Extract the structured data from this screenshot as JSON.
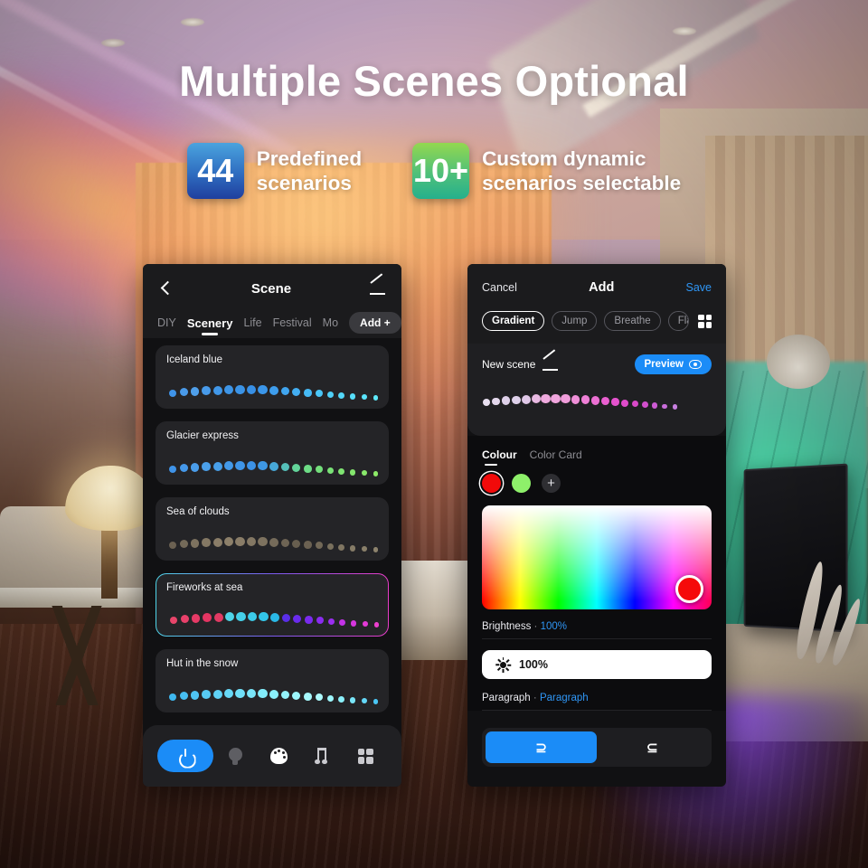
{
  "promo": {
    "headline": "Multiple Scenes Optional",
    "badges": [
      {
        "value": "44",
        "line1": "Predefined",
        "line2": "scenarios",
        "color": "#2f6dc0"
      },
      {
        "value": "10+",
        "line1": "Custom dynamic",
        "line2": "scenarios selectable",
        "color": "#4fc07a"
      }
    ]
  },
  "left_phone": {
    "header": {
      "back_icon": "chevron-left-icon",
      "title": "Scene",
      "edit_icon": "pencil-icon"
    },
    "tabs": [
      {
        "label": "DIY",
        "active": false
      },
      {
        "label": "Scenery",
        "active": true
      },
      {
        "label": "Life",
        "active": false
      },
      {
        "label": "Festival",
        "active": false
      },
      {
        "label": "Mo",
        "active": false
      }
    ],
    "add_button": "Add +",
    "scenes": [
      {
        "name": "Iceland blue",
        "selected": false,
        "colors": [
          "#3f93e8",
          "#4a9ae9",
          "#4f9fea",
          "#489ae9",
          "#4197e8",
          "#3e95e7",
          "#3b93e6",
          "#3890e6",
          "#3b96ea",
          "#3e9ded",
          "#40a5ef",
          "#43aef2",
          "#46baf5",
          "#4ac6f7",
          "#4fd0f8",
          "#53d8f9",
          "#57dffa",
          "#5ae4fb",
          "#5ee9fb"
        ]
      },
      {
        "name": "Glacier express",
        "selected": false,
        "colors": [
          "#3f93e8",
          "#4598e9",
          "#4a9dea",
          "#4ba0ea",
          "#489fe9",
          "#4399e8",
          "#3f95e7",
          "#3c92e6",
          "#3e97e4",
          "#47a8d8",
          "#55bfb9",
          "#63d49a",
          "#6ddc86",
          "#74df7c",
          "#7ae277",
          "#7fe472",
          "#84e66e",
          "#88e86b",
          "#8dea68"
        ]
      },
      {
        "name": "Sea of clouds",
        "selected": false,
        "colors": [
          "#6b6152",
          "#746a59",
          "#7d725f",
          "#847864",
          "#8a7d68",
          "#8d806a",
          "#8a7d68",
          "#847864",
          "#7d725f",
          "#756b5a",
          "#6e6454",
          "#675e4f",
          "#6b6152",
          "#726857",
          "#79705d",
          "#807662",
          "#867c67",
          "#8a806a",
          "#8d836d"
        ]
      },
      {
        "name": "Fireworks at sea",
        "selected": true,
        "colors": [
          "#e8456a",
          "#e8406a",
          "#e63a66",
          "#e43562",
          "#e13a63",
          "#4fd4e8",
          "#45cfe8",
          "#3ccbe9",
          "#33c6e9",
          "#2ab8e6",
          "#5a2ee8",
          "#6a2bec",
          "#7a2bee",
          "#8a2cef",
          "#9a2ef0",
          "#c233e6",
          "#d636de",
          "#e33ad6",
          "#ec3fce"
        ]
      },
      {
        "name": "Hut in the snow",
        "selected": false,
        "colors": [
          "#3fb8f0",
          "#47bef2",
          "#4fc4f3",
          "#57cbf4",
          "#5fd2f6",
          "#67d9f7",
          "#70e0f8",
          "#79e6f9",
          "#82ecfa",
          "#8bf0fb",
          "#94f3fb",
          "#9df6fc",
          "#a6f8fc",
          "#aefafd",
          "#9df6fc",
          "#8bf0fb",
          "#79e6f9",
          "#63d6f6",
          "#4ac6f4"
        ]
      }
    ],
    "toolbar": {
      "power_icon": "power-icon",
      "items": [
        {
          "icon": "bulb-icon",
          "active": false
        },
        {
          "icon": "palette-icon",
          "active": true
        },
        {
          "icon": "music-note-icon",
          "active": false
        },
        {
          "icon": "grid-icon",
          "active": false
        }
      ]
    }
  },
  "right_phone": {
    "header": {
      "cancel": "Cancel",
      "title": "Add",
      "save": "Save"
    },
    "modes": [
      {
        "label": "Gradient",
        "active": true
      },
      {
        "label": "Jump",
        "active": false
      },
      {
        "label": "Breathe",
        "active": false
      },
      {
        "label": "Flashing",
        "active": false
      }
    ],
    "mode_grid_icon": "grid-icon",
    "scene": {
      "name": "New scene",
      "edit_icon": "pencil-icon",
      "preview_label": "Preview",
      "preview_icon": "eye-icon",
      "preview_colors": [
        "#e8dff0",
        "#e3d7ec",
        "#ded0e9",
        "#ded0ea",
        "#e0c8e8",
        "#e8b9e2",
        "#efaade",
        "#f0a5dd",
        "#f09ddb",
        "#ef8fd8",
        "#ee7fd6",
        "#ec6fd3",
        "#e95fd0",
        "#e452cd",
        "#df4bcb",
        "#d949c9",
        "#d24fcd",
        "#cc5ad3",
        "#c96cda",
        "#c87fe0"
      ]
    },
    "color_tabs": [
      {
        "label": "Colour",
        "active": true
      },
      {
        "label": "Color Card",
        "active": false
      }
    ],
    "swatches": [
      {
        "color": "#f20a0a",
        "selected": true
      },
      {
        "color": "#8ef06a",
        "selected": false
      }
    ],
    "add_swatch_label": "+",
    "picker": {
      "selected_color": "#f50a0a",
      "knob_name": "color-picker-knob"
    },
    "brightness": {
      "label": "Brightness",
      "separator": "·",
      "value": "100%",
      "slider_icon": "sun-icon",
      "slider_value": "100%"
    },
    "paragraph": {
      "label": "Paragraph",
      "separator": "·",
      "value": "Paragraph"
    },
    "direction": [
      {
        "icon": "flow-forward-icon",
        "active": true
      },
      {
        "icon": "flow-reverse-icon",
        "active": false
      }
    ]
  }
}
